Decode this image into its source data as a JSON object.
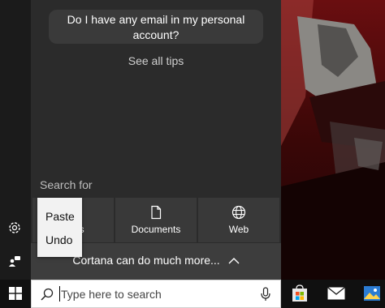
{
  "cortana": {
    "suggestion": "Do I have any email in my personal account?",
    "see_all_tips": "See all tips",
    "search_for_label": "Search for",
    "categories": [
      {
        "label": "Apps",
        "icon": "apps-icon"
      },
      {
        "label": "Documents",
        "icon": "document-icon"
      },
      {
        "label": "Web",
        "icon": "globe-icon"
      }
    ],
    "more_label": "Cortana can do much more...",
    "more_icon": "chevron-up-icon"
  },
  "context_menu": {
    "items": [
      "Paste",
      "Undo"
    ]
  },
  "taskbar": {
    "search_placeholder": "Type here to search",
    "search_value": "",
    "start_icon": "windows-logo-icon",
    "pinned": [
      "store-icon",
      "mail-icon",
      "photos-icon"
    ]
  },
  "rail": {
    "icons": [
      "settings-icon",
      "feedback-icon"
    ]
  }
}
